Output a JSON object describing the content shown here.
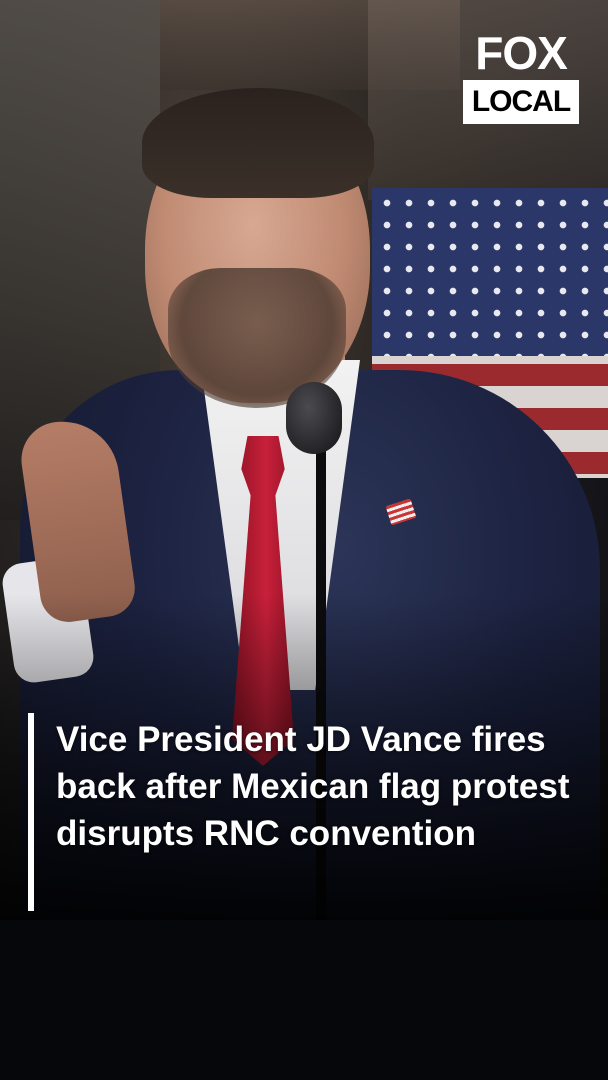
{
  "logo": {
    "brand": "FOX",
    "sub": "LOCAL"
  },
  "caption": {
    "text": "Vice President JD Vance fires back after Mexican flag protest disrupts RNC convention"
  },
  "colors": {
    "caption_text": "#ffffff",
    "caption_accent_bar": "#ffffff",
    "background": "#06070a"
  }
}
